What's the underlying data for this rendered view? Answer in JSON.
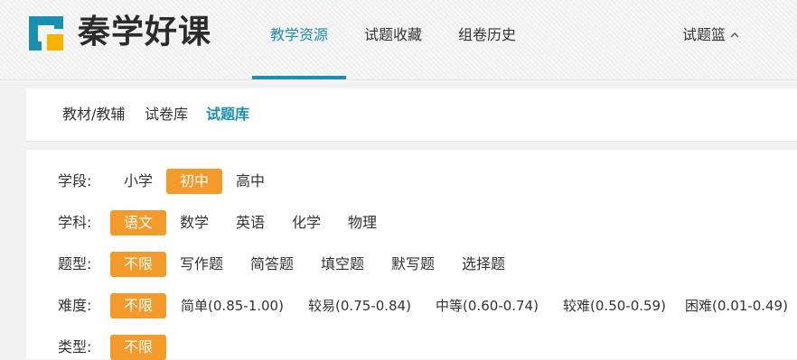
{
  "brand": {
    "name": "秦学好课",
    "logo_colors": {
      "primary": "#1b8fb0",
      "accent": "#f5b400"
    }
  },
  "nav": {
    "items": [
      {
        "label": "教学资源",
        "active": true
      },
      {
        "label": "试题收藏",
        "active": false
      },
      {
        "label": "组卷历史",
        "active": false
      }
    ],
    "basket": {
      "label": "试题篮",
      "icon": "chevron-up-icon"
    }
  },
  "subtabs": [
    {
      "label": "教材/教辅",
      "active": false
    },
    {
      "label": "试卷库",
      "active": false
    },
    {
      "label": "试题库",
      "active": true
    }
  ],
  "filters": {
    "stage": {
      "label": "学段:",
      "options": [
        "小学",
        "初中",
        "高中"
      ],
      "selected": "初中"
    },
    "subject": {
      "label": "学科:",
      "options": [
        "语文",
        "数学",
        "英语",
        "化学",
        "物理"
      ],
      "selected": "语文"
    },
    "question_type": {
      "label": "题型:",
      "options": [
        "不限",
        "写作题",
        "简答题",
        "填空题",
        "默写题",
        "选择题"
      ],
      "selected": "不限"
    },
    "difficulty": {
      "label": "难度:",
      "options": [
        "不限",
        "简单(0.85-1.00)",
        "较易(0.75-0.84)",
        "中等(0.60-0.74)",
        "较难(0.50-0.59)",
        "困难(0.01-0.49)"
      ],
      "selected": "不限"
    },
    "category": {
      "label": "类型:",
      "options": [
        "不限"
      ],
      "selected": "不限"
    }
  },
  "colors": {
    "accent": "#1b8fb0",
    "selected": "#f39a2a"
  }
}
